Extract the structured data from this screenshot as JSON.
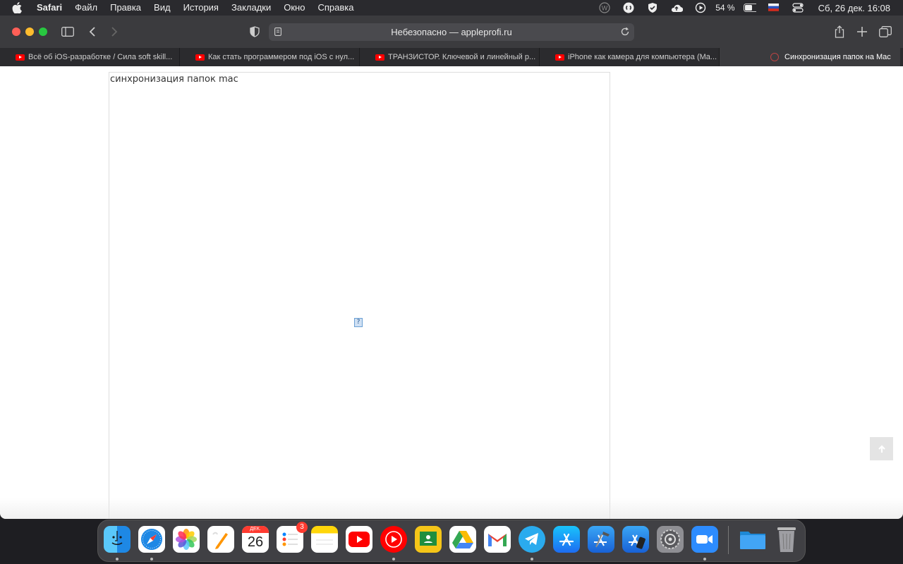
{
  "menubar": {
    "app_name": "Safari",
    "items": [
      "Файл",
      "Правка",
      "Вид",
      "История",
      "Закладки",
      "Окно",
      "Справка"
    ],
    "battery": "54 %",
    "datetime": "Сб, 26 дек.  16:08",
    "icons": [
      "apple-logo",
      "w-icon",
      "shazam-icon",
      "shield-check-icon",
      "cloud-upload-icon",
      "play-circle-icon",
      "battery-icon",
      "flag-ru-icon",
      "control-center-icon"
    ]
  },
  "toolbar": {
    "address": "Небезопасно — appleprofi.ru"
  },
  "tabs": [
    {
      "title": "Всё об iOS-разработке / Сила soft skill...",
      "icon": "youtube"
    },
    {
      "title": "Как стать программером под iOS с нул...",
      "icon": "youtube"
    },
    {
      "title": "ТРАНЗИСТОР. Ключевой и линейный р...",
      "icon": "youtube"
    },
    {
      "title": "iPhone как камера для компьютера (Ma...",
      "icon": "youtube"
    },
    {
      "title": "Синхронизация папок на Mac",
      "icon": "site",
      "active": true
    }
  ],
  "page": {
    "text": "синхронизация папок mac",
    "broken_image_glyph": "?"
  },
  "dock": {
    "apps": [
      "Finder",
      "Safari",
      "Photos",
      "Pages",
      "Calendar",
      "Reminders",
      "Notes",
      "YouTube",
      "YouTube Music",
      "Google Classroom",
      "Google Drive",
      "Gmail",
      "Telegram",
      "App Store",
      "Xcode",
      "Simulator",
      "System Preferences",
      "Zoom",
      "Downloads",
      "Trash"
    ],
    "calendar_month": "ДЕК.",
    "calendar_day": "26",
    "reminders_badge": "3"
  },
  "colors": {
    "accent": "#0a84ff",
    "close": "#ff5f57",
    "minimize": "#febc2e",
    "maximize": "#28c840"
  }
}
